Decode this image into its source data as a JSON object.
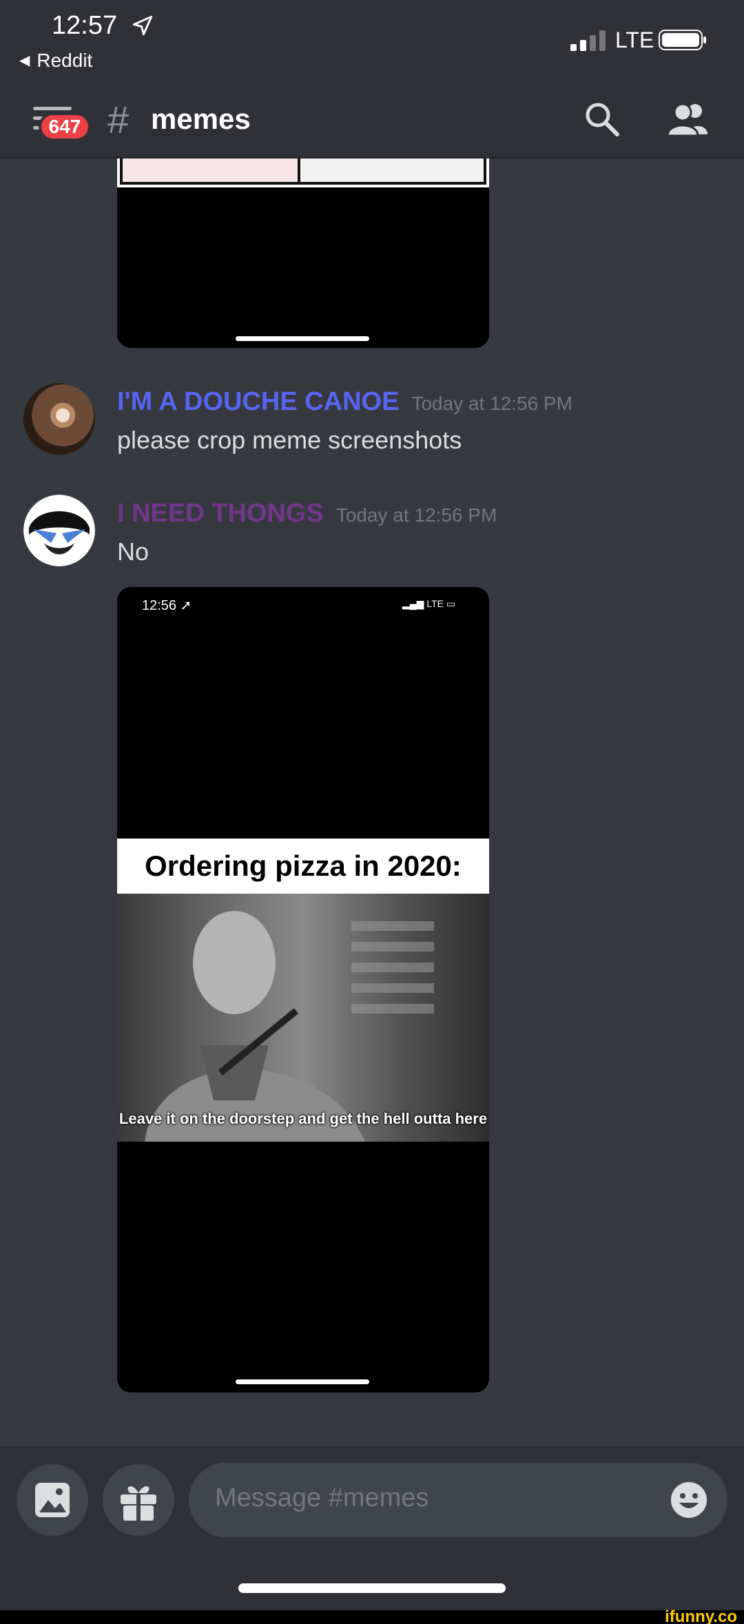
{
  "status_bar": {
    "time": "12:57",
    "back_app": "Reddit",
    "network": "LTE"
  },
  "header": {
    "unread_badge": "647",
    "hash": "#",
    "channel_name": "memes"
  },
  "messages": [
    {
      "author": "I'M A DOUCHE CANOE",
      "author_color": "#5865f2",
      "timestamp": "Today at 12:56 PM",
      "text": "please crop meme screenshots"
    },
    {
      "author": "I NEED THONGS",
      "author_color": "#71368a",
      "timestamp": "Today at 12:56 PM",
      "text": "No",
      "attachment": {
        "status_time": "12:56",
        "status_network": "LTE",
        "caption": "Ordering pizza in 2020:",
        "subtitle": "Leave it on the doorstep and get the hell outta here"
      }
    }
  ],
  "composer": {
    "placeholder": "Message #memes"
  },
  "watermark": "ifunny.co",
  "colors": {
    "background": "#36393f",
    "header_bg": "#2f3136",
    "badge": "#ed4245"
  }
}
